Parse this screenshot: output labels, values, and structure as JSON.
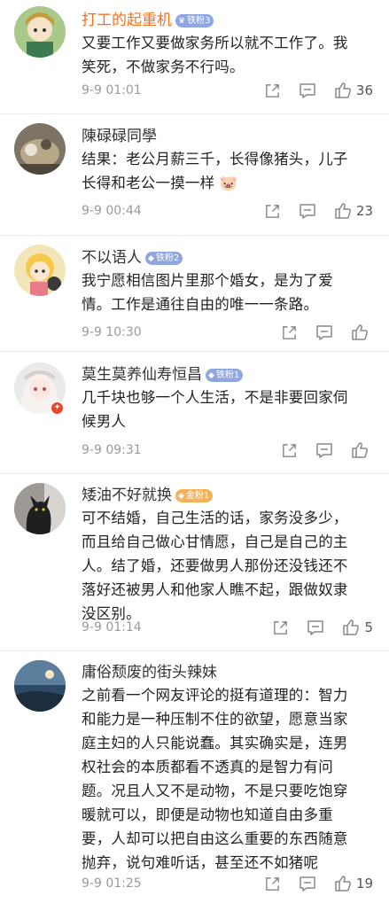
{
  "comments": [
    {
      "username": "打工的起重机",
      "badge": "铁粉3",
      "text": "又要工作又要做家务所以就不工作了。我\n笑死，不做家务不行吗。",
      "time": "9-9 01:01",
      "likes": "36"
    },
    {
      "username": "陳碌碌同學",
      "text": "结果：老公月薪三千，长得像猪头，儿子\n长得和老公一摸一样 🐷",
      "time": "9-9 00:44",
      "likes": "23"
    },
    {
      "username": "不以语人",
      "badge": "铁粉2",
      "text": "我宁愿相信图片里那个婚女，是为了爱\n情。工作是通往自由的唯一一条路。",
      "time": "9-9 10:30",
      "likes": ""
    },
    {
      "username": "莫生莫养仙寿恒昌",
      "badge": "铁粉1",
      "text": "几千块也够一个人生活，不是非要回家伺\n候男人",
      "time": "9-9 09:31",
      "likes": ""
    },
    {
      "username": "矮油不好就换",
      "badge": "金粉1",
      "text": "可不结婚，自己生活的话，家务没多少，\n而且给自己做心甘情愿，自己是自己的主\n人。结了婚，还要做男人那份还没钱还不\n落好还被男人和他家人瞧不起，跟做奴隶\n没区别。",
      "time": "9-9 01:14",
      "likes": "5"
    },
    {
      "username": "庸俗颓废的街头辣妹",
      "text": "之前看一个网友评论的挺有道理的：智力\n和能力是一种压制不住的欲望，愿意当家\n庭主妇的人只能说蠢。其实确实是，连男\n权社会的本质都看不透真的是智力有问\n题。况且人又不是动物，不是只要吃饱穿\n暖就可以，即便是动物也知道自由多重\n要，人却可以把自由这么重要的东西随意\n抛弃，说句难听话，甚至还不如猪呢",
      "time": "9-9 01:25",
      "likes": "19"
    }
  ]
}
